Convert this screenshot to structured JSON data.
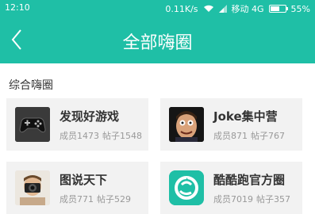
{
  "status_bar": {
    "time": "12:10",
    "speed": "0.11K/s",
    "carrier": "移动 4G",
    "battery": "55%"
  },
  "header": {
    "title": "全部嗨圈"
  },
  "section": {
    "title": "综合嗨圈"
  },
  "groups": [
    {
      "name": "发现好游戏",
      "members": "成员1473",
      "posts": "帖子1548",
      "icon": "gamepad-icon"
    },
    {
      "name": "Joke集中营",
      "members": "成员871",
      "posts": "帖子767",
      "icon": "funny-face-avatar"
    },
    {
      "name": "图说天下",
      "members": "成员771",
      "posts": "帖子529",
      "icon": "photographer-avatar"
    },
    {
      "name": "酷酷跑官方圈",
      "members": "成员7019",
      "posts": "帖子357",
      "icon": "kukupao-logo"
    }
  ],
  "colors": {
    "accent": "#1fbfa6"
  }
}
